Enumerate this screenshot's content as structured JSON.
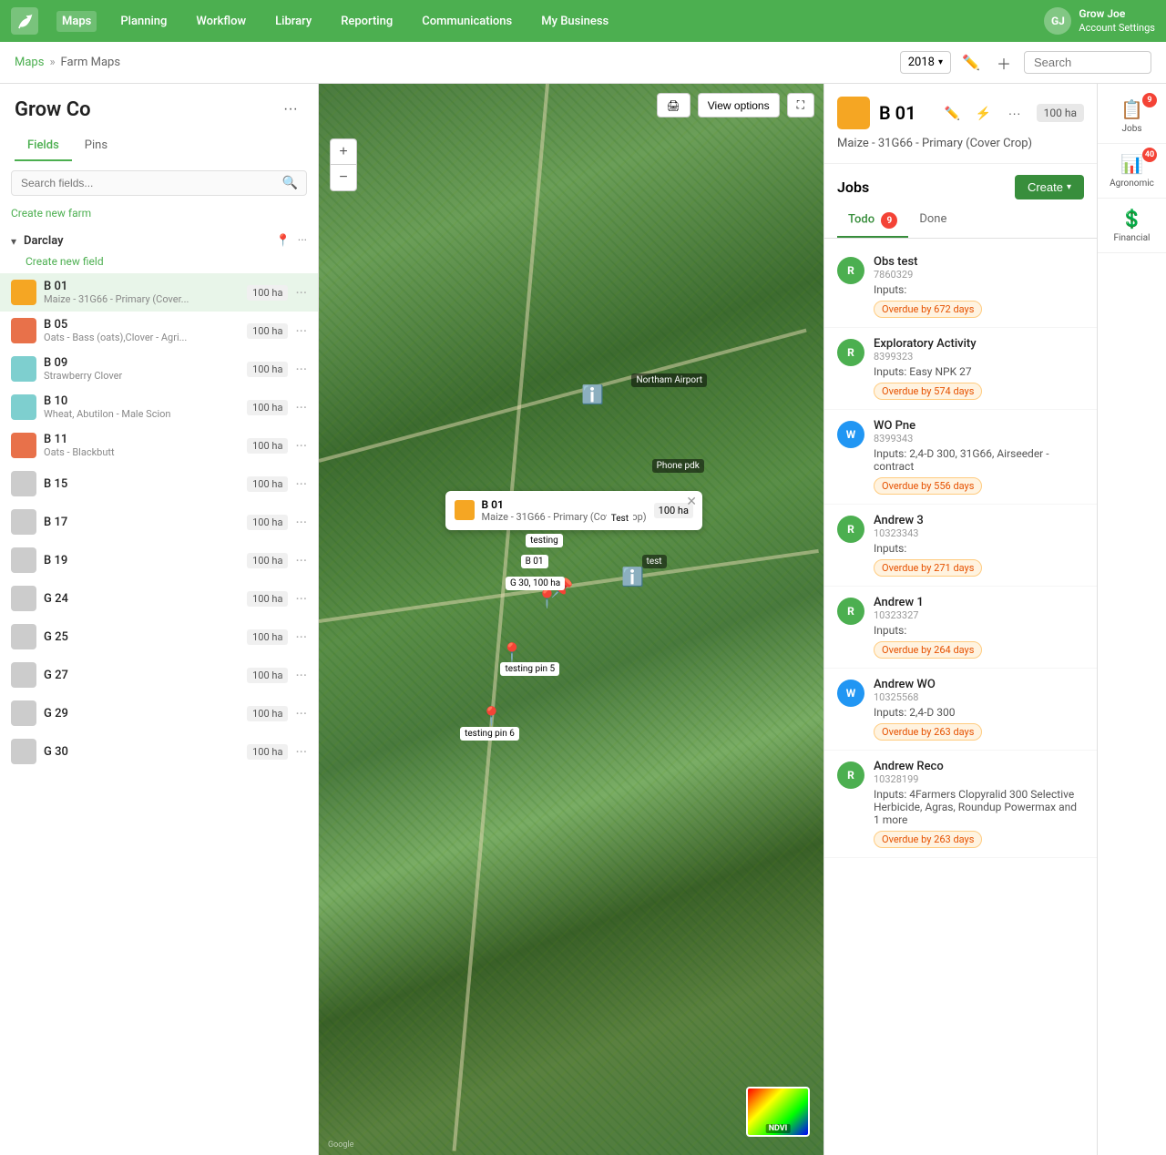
{
  "nav": {
    "logo": "🌱",
    "items": [
      "Maps",
      "Planning",
      "Workflow",
      "Library",
      "Reporting",
      "Communications",
      "My Business"
    ],
    "active": "Maps",
    "user": {
      "name": "Grow Joe",
      "subtitle": "Account Settings"
    }
  },
  "second_bar": {
    "breadcrumb": [
      "Maps",
      "Farm Maps"
    ],
    "year": "2018",
    "search_placeholder": "Search"
  },
  "sidebar": {
    "title": "Grow Co",
    "tabs": [
      "Fields",
      "Pins"
    ],
    "active_tab": "Fields",
    "search_placeholder": "Search fields...",
    "create_farm": "Create new farm",
    "farm_name": "Darclay",
    "create_field": "Create new field",
    "fields": [
      {
        "name": "B 01",
        "crop": "Maize - 31G66 - Primary (Cover...",
        "ha": "100 ha",
        "color": "#f5a623",
        "selected": true
      },
      {
        "name": "B 05",
        "crop": "Oats - Bass (oats),Clover - Agri...",
        "ha": "100 ha",
        "color": "#e8714a",
        "selected": false
      },
      {
        "name": "B 09",
        "crop": "Strawberry Clover",
        "ha": "100 ha",
        "color": "#7ecfcf",
        "selected": false
      },
      {
        "name": "B 10",
        "crop": "Wheat, Abutilon - Male Scion",
        "ha": "100 ha",
        "color": "#7ecfcf",
        "selected": false
      },
      {
        "name": "B 11",
        "crop": "Oats - Blackbutt",
        "ha": "100 ha",
        "color": "#e8714a",
        "selected": false
      },
      {
        "name": "B 15",
        "crop": "",
        "ha": "100 ha",
        "color": "#cccccc",
        "selected": false
      },
      {
        "name": "B 17",
        "crop": "",
        "ha": "100 ha",
        "color": "#cccccc",
        "selected": false
      },
      {
        "name": "B 19",
        "crop": "",
        "ha": "100 ha",
        "color": "#cccccc",
        "selected": false
      },
      {
        "name": "G 24",
        "crop": "",
        "ha": "100 ha",
        "color": "#cccccc",
        "selected": false
      },
      {
        "name": "G 25",
        "crop": "",
        "ha": "100 ha",
        "color": "#cccccc",
        "selected": false
      },
      {
        "name": "G 27",
        "crop": "",
        "ha": "100 ha",
        "color": "#cccccc",
        "selected": false
      },
      {
        "name": "G 29",
        "crop": "",
        "ha": "100 ha",
        "color": "#cccccc",
        "selected": false
      },
      {
        "name": "G 30",
        "crop": "",
        "ha": "100 ha",
        "color": "#cccccc",
        "selected": false
      }
    ]
  },
  "map_toolbar": {
    "print": "🖨",
    "view_options": "View options",
    "fullscreen": "⛶",
    "zoom_in": "+",
    "zoom_out": "−"
  },
  "map_popup": {
    "name": "B 01",
    "crop": "Maize - 31G66 - Primary (Cover Crop)",
    "ha": "100 ha"
  },
  "field_detail": {
    "name": "B 01",
    "crop": "Maize - 31G66 - Primary (Cover Crop)",
    "ha": "100 ha",
    "color": "#f5a623"
  },
  "jobs": {
    "title": "Jobs",
    "create_label": "Create",
    "tabs": [
      "Todo",
      "Done"
    ],
    "active_tab": "Todo",
    "todo_count": 9,
    "items": [
      {
        "name": "Obs test",
        "id": "7860329",
        "inputs": "Inputs:",
        "overdue": "Overdue by 672 days",
        "avatar_letter": "R",
        "avatar_type": "green"
      },
      {
        "name": "Exploratory Activity",
        "id": "8399323",
        "inputs": "Inputs: Easy NPK 27",
        "overdue": "Overdue by 574 days",
        "avatar_letter": "R",
        "avatar_type": "green"
      },
      {
        "name": "WO Pne",
        "id": "8399343",
        "inputs": "Inputs: 2,4-D 300, 31G66, Airseeder - contract",
        "overdue": "Overdue by 556 days",
        "avatar_letter": "W",
        "avatar_type": "blue"
      },
      {
        "name": "Andrew 3",
        "id": "10323343",
        "inputs": "Inputs:",
        "overdue": "Overdue by 271 days",
        "avatar_letter": "R",
        "avatar_type": "green"
      },
      {
        "name": "Andrew 1",
        "id": "10323327",
        "inputs": "Inputs:",
        "overdue": "Overdue by 264 days",
        "avatar_letter": "R",
        "avatar_type": "green"
      },
      {
        "name": "Andrew WO",
        "id": "10325568",
        "inputs": "Inputs: 2,4-D 300",
        "overdue": "Overdue by 263 days",
        "avatar_letter": "W",
        "avatar_type": "blue"
      },
      {
        "name": "Andrew Reco",
        "id": "10328199",
        "inputs": "Inputs: 4Farmers Clopyralid 300 Selective Herbicide, Agras, Roundup Powermax and 1 more",
        "overdue": "Overdue by 263 days",
        "avatar_letter": "R",
        "avatar_type": "green"
      }
    ]
  },
  "far_right": {
    "jobs_count": "9",
    "jobs_label": "Jobs",
    "agro_count": "40",
    "agro_label": "Agronomic",
    "fin_label": "Financial"
  }
}
